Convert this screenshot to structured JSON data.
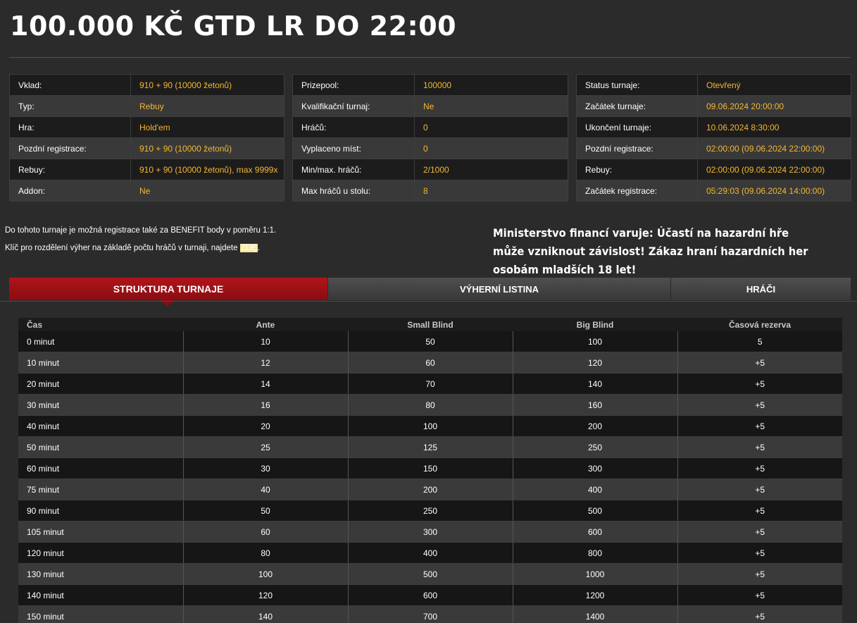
{
  "title": "100.000 KČ GTD LR DO 22:00",
  "info_tables": [
    {
      "rows": [
        {
          "label": "Vklad:",
          "value": "910 + 90 (10000 žetonů)"
        },
        {
          "label": "Typ:",
          "value": "Rebuy"
        },
        {
          "label": "Hra:",
          "value": "Hold'em"
        },
        {
          "label": "Pozdní registrace:",
          "value": "910 + 90 (10000 žetonů)"
        },
        {
          "label": "Rebuy:",
          "value": "910 + 90 (10000 žetonů), max 9999x"
        },
        {
          "label": "Addon:",
          "value": "Ne"
        }
      ]
    },
    {
      "rows": [
        {
          "label": "Prizepool:",
          "value": "100000"
        },
        {
          "label": "Kvalifikační turnaj:",
          "value": "Ne"
        },
        {
          "label": "Hráčů:",
          "value": "0"
        },
        {
          "label": "Vyplaceno míst:",
          "value": "0"
        },
        {
          "label": "Min/max. hráčů:",
          "value": "2/1000"
        },
        {
          "label": "Max hráčů u stolu:",
          "value": "8"
        }
      ]
    },
    {
      "rows": [
        {
          "label": "Status turnaje:",
          "value": "Otevřený"
        },
        {
          "label": "Začátek turnaje:",
          "value": "09.06.2024 20:00:00"
        },
        {
          "label": "Ukončení turnaje:",
          "value": "10.06.2024 8:30:00"
        },
        {
          "label": "Pozdní registrace:",
          "value": "02:00:00 (09.06.2024 22:00:00)"
        },
        {
          "label": "Rebuy:",
          "value": "02:00:00 (09.06.2024 22:00:00)"
        },
        {
          "label": "Začátek registrace:",
          "value": "05:29:03 (09.06.2024 14:00:00)"
        }
      ]
    }
  ],
  "notes": {
    "benefit": "Do tohoto turnaje je možná registrace také za BENEFIT body v poměru 1:1.",
    "key_prefix": "Klíč pro rozdělení výher na základě počtu hráčů v turnaji, najdete ",
    "key_link": "ZDE",
    "key_suffix": "."
  },
  "warning": "Ministerstvo financí varuje: Účastí na hazardní hře může vzniknout závislost! Zákaz hraní hazardních her osobám mladších 18 let!",
  "tabs": [
    {
      "label": "STRUKTURA TURNAJE",
      "active": true
    },
    {
      "label": "VÝHERNÍ LISTINA",
      "active": false
    },
    {
      "label": "HRÁČI",
      "active": false
    }
  ],
  "structure": {
    "headers": [
      "Čas",
      "Ante",
      "Small Blind",
      "Big Blind",
      "Časová rezerva"
    ],
    "rows": [
      [
        "0 minut",
        "10",
        "50",
        "100",
        "5"
      ],
      [
        "10 minut",
        "12",
        "60",
        "120",
        "+5"
      ],
      [
        "20 minut",
        "14",
        "70",
        "140",
        "+5"
      ],
      [
        "30 minut",
        "16",
        "80",
        "160",
        "+5"
      ],
      [
        "40 minut",
        "20",
        "100",
        "200",
        "+5"
      ],
      [
        "50 minut",
        "25",
        "125",
        "250",
        "+5"
      ],
      [
        "60 minut",
        "30",
        "150",
        "300",
        "+5"
      ],
      [
        "75 minut",
        "40",
        "200",
        "400",
        "+5"
      ],
      [
        "90 minut",
        "50",
        "250",
        "500",
        "+5"
      ],
      [
        "105 minut",
        "60",
        "300",
        "600",
        "+5"
      ],
      [
        "120 minut",
        "80",
        "400",
        "800",
        "+5"
      ],
      [
        "130 minut",
        "100",
        "500",
        "1000",
        "+5"
      ],
      [
        "140 minut",
        "120",
        "600",
        "1200",
        "+5"
      ],
      [
        "150 minut",
        "140",
        "700",
        "1400",
        "+5"
      ]
    ]
  },
  "colors": {
    "background": "#2b2b2b",
    "value_accent": "#f5b731",
    "active_tab": "#b0141a",
    "row_dark": "#1c1c1c",
    "row_light": "#393939"
  }
}
